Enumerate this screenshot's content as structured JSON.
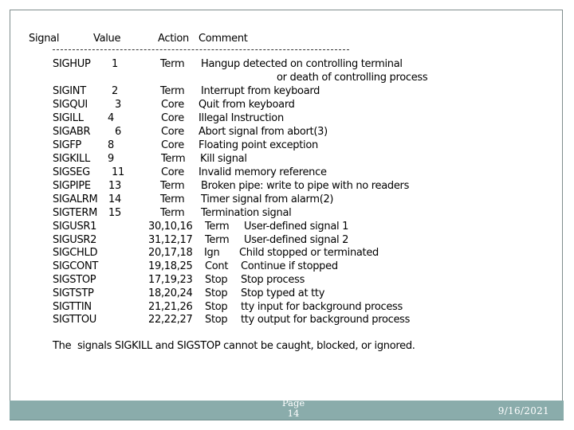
{
  "header": {
    "signal": "Signal",
    "value": "Value",
    "action": "Action",
    "comment": "Comment"
  },
  "separator": "----------------------------------------------------------------------",
  "rows": [
    {
      "signal": "SIGHUP",
      "value": "1",
      "action": "Term",
      "comment": "Hangup detected on controlling terminal",
      "comment2": "or death of controlling process"
    },
    {
      "signal": "SIGINT",
      "value": "2",
      "action": "Term",
      "comment": "Interrupt from keyboard"
    },
    {
      "signal": "SIGQUI",
      "value": "3",
      "action": "Core",
      "comment": "Quit from keyboard"
    },
    {
      "signal": "SIGILL",
      "value": "4",
      "action": "Core",
      "comment": "Illegal Instruction"
    },
    {
      "signal": "SIGABR",
      "value": "6",
      "action": "Core",
      "comment": "Abort signal from abort(3)"
    },
    {
      "signal": "SIGFP",
      "value": "8",
      "action": "Core",
      "comment": "Floating point exception"
    },
    {
      "signal": "SIGKILL",
      "value": "9",
      "action": "Term",
      "comment": "Kill signal"
    },
    {
      "signal": "SIGSEG",
      "value": "11",
      "action": "Core",
      "comment": "Invalid memory reference"
    },
    {
      "signal": "SIGPIPE",
      "value": "13",
      "action": "Term",
      "comment": "Broken pipe: write to pipe with no readers"
    },
    {
      "signal": "SIGALRM",
      "value": "14",
      "action": "Term",
      "comment": "Timer signal from alarm(2)"
    },
    {
      "signal": "SIGTERM",
      "value": "15",
      "action": "Term",
      "comment": "Termination signal"
    },
    {
      "signal": "SIGUSR1",
      "value": "30,10,16",
      "action": "Term",
      "comment": "User-defined signal 1"
    },
    {
      "signal": "SIGUSR2",
      "value": "31,12,17",
      "action": "Term",
      "comment": "User-defined signal 2"
    },
    {
      "signal": "SIGCHLD",
      "value": "20,17,18",
      "action": "Ign",
      "comment": "Child stopped or terminated"
    },
    {
      "signal": "SIGCONT",
      "value": "19,18,25",
      "action": "Cont",
      "comment": "Continue if stopped"
    },
    {
      "signal": "SIGSTOP",
      "value": "17,19,23",
      "action": "Stop",
      "comment": "Stop process"
    },
    {
      "signal": "SIGTSTP",
      "value": "18,20,24",
      "action": "Stop",
      "comment": "Stop typed at tty"
    },
    {
      "signal": "SIGTTIN",
      "value": "21,21,26",
      "action": "Stop",
      "comment": "tty input for background process"
    },
    {
      "signal": "SIGTTOU",
      "value": "22,22,27",
      "action": "Stop",
      "comment": "tty output for background process"
    }
  ],
  "note": "The  signals SIGKILL and SIGSTOP cannot be caught, blocked, or ignored.",
  "footer": {
    "page_label": "Page",
    "page_number": "14",
    "date": "9/16/2021"
  }
}
